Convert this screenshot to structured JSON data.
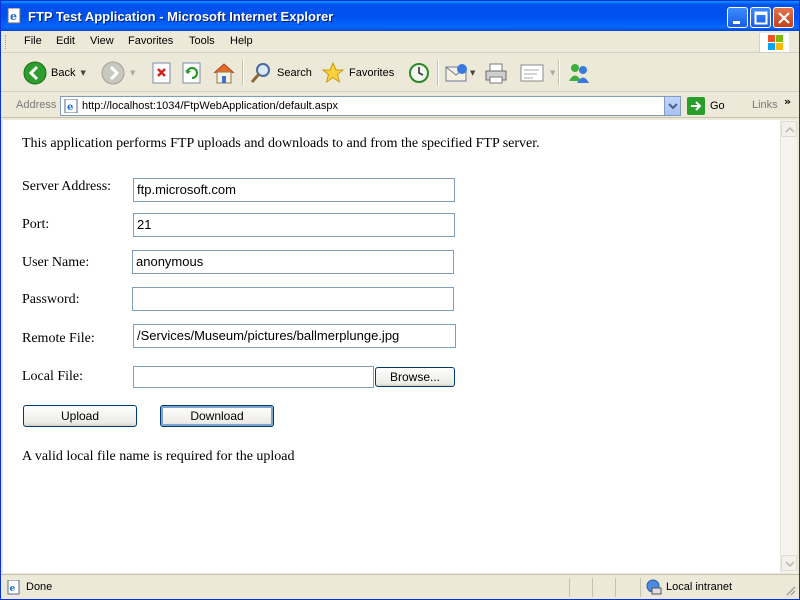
{
  "window": {
    "title": "FTP Test Application - Microsoft Internet Explorer"
  },
  "menu": [
    "File",
    "Edit",
    "View",
    "Favorites",
    "Tools",
    "Help"
  ],
  "toolbar": {
    "back_label": "Back",
    "search_label": "Search",
    "favorites_label": "Favorites"
  },
  "address": {
    "label": "Address",
    "url": "http://localhost:1034/FtpWebApplication/default.aspx",
    "go_label": "Go",
    "links_label": "Links"
  },
  "page": {
    "intro": "This application performs FTP uploads and downloads to and from the specified FTP server.",
    "fields": {
      "server_label": "Server Address:",
      "server_value": "ftp.microsoft.com",
      "port_label": "Port:",
      "port_value": "21",
      "user_label": "User Name:",
      "user_value": "anonymous",
      "password_label": "Password:",
      "password_value": "",
      "remote_label": "Remote File:",
      "remote_value": "/Services/Museum/pictures/ballmerplunge.jpg",
      "local_label": "Local File:",
      "local_value": "",
      "browse_label": "Browse..."
    },
    "upload_label": "Upload",
    "download_label": "Download",
    "message": "A valid local file name is required for the upload"
  },
  "status": {
    "text": "Done",
    "zone": "Local intranet"
  },
  "colors": {
    "titlebar": "#0054e3",
    "chrome": "#ece9d8",
    "input_border": "#7f9db9",
    "button_border": "#003c74"
  },
  "icons": {
    "app": "ie-page-icon",
    "back": "back-arrow-icon",
    "forward": "forward-arrow-icon",
    "stop": "stop-icon",
    "refresh": "refresh-icon",
    "home": "home-icon",
    "search": "search-icon",
    "favorites": "favorites-star-icon",
    "history": "history-icon",
    "mail": "mail-icon",
    "print": "print-icon",
    "edit": "edit-icon",
    "messenger": "messenger-icon"
  }
}
